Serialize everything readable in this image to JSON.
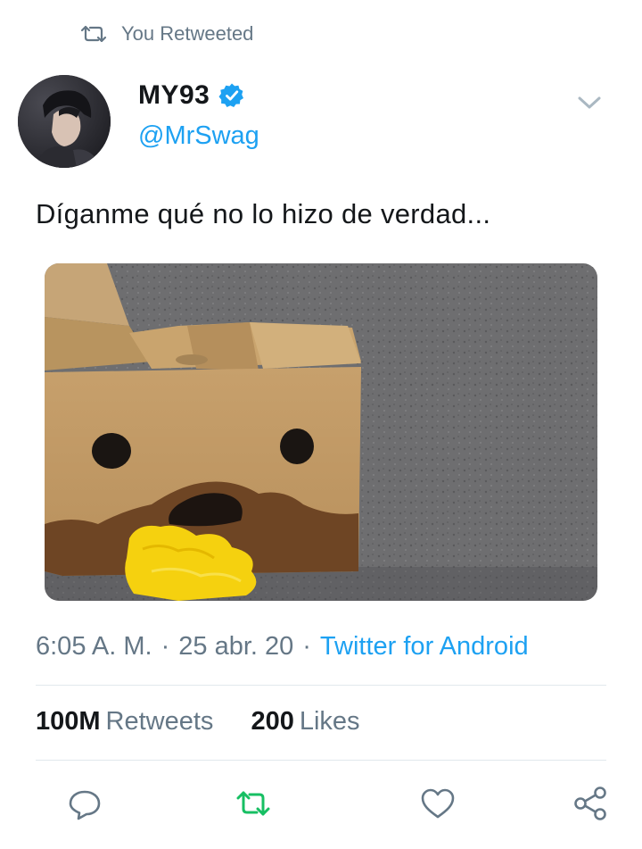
{
  "retweet_banner": {
    "text": "You Retweeted",
    "icon": "retweet-icon"
  },
  "author": {
    "display_name": "MY93",
    "handle": "@MrSwag",
    "verified": true,
    "avatar": "avatar"
  },
  "tweet": {
    "text": "Díganme qué no lo hizo de verdad...",
    "media": "photo-cardboard-box-face"
  },
  "meta": {
    "time": "6:05 A. M.",
    "date": "25 abr. 20",
    "separator": "·",
    "source": "Twitter for Android"
  },
  "stats": {
    "retweets_count": "100M",
    "retweets_label": "Retweets",
    "likes_count": "200",
    "likes_label": "Likes"
  },
  "actions": {
    "reply": "reply-icon",
    "retweet": "retweet-icon",
    "like": "heart-icon",
    "share": "share-icon"
  },
  "colors": {
    "accent": "#1da1f2",
    "retweeted": "#17bf63",
    "muted": "#657786",
    "text": "#14171a",
    "divider": "#e1e8ed"
  }
}
